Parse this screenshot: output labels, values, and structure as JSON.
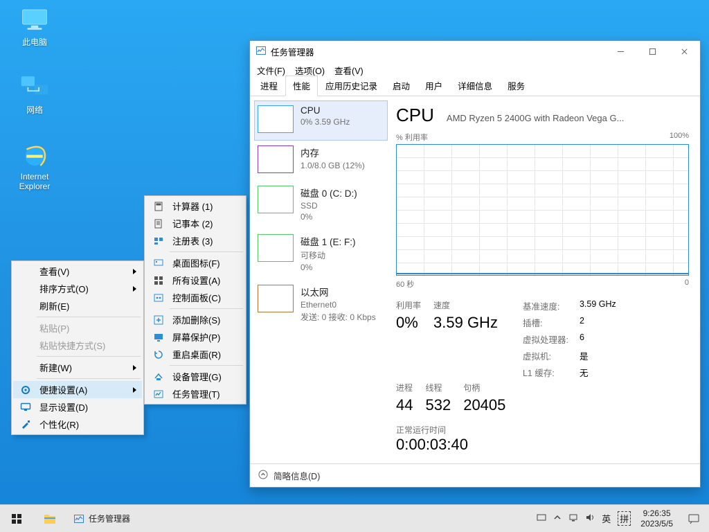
{
  "desktop": {
    "icons": [
      {
        "key": "this-pc",
        "label": "此电脑"
      },
      {
        "key": "network",
        "label": "网络"
      },
      {
        "key": "ie",
        "label": "Internet Explorer"
      }
    ]
  },
  "context_menu": {
    "items": [
      {
        "label": "查看(V)",
        "type": "submenu"
      },
      {
        "label": "排序方式(O)",
        "type": "submenu"
      },
      {
        "label": "刷新(E)",
        "type": "item"
      },
      {
        "label": "sep"
      },
      {
        "label": "粘贴(P)",
        "type": "disabled"
      },
      {
        "label": "粘贴快捷方式(S)",
        "type": "disabled"
      },
      {
        "label": "sep"
      },
      {
        "label": "新建(W)",
        "type": "submenu"
      },
      {
        "label": "sep"
      },
      {
        "label": "便捷设置(A)",
        "type": "submenu",
        "icon": "gear",
        "active": true
      },
      {
        "label": "显示设置(D)",
        "type": "item",
        "icon": "display"
      },
      {
        "label": "个性化(R)",
        "type": "item",
        "icon": "brush"
      }
    ],
    "submenu": [
      {
        "label": "计算器  (1)",
        "icon": "calc"
      },
      {
        "label": "记事本  (2)",
        "icon": "notepad"
      },
      {
        "label": "注册表  (3)",
        "icon": "registry"
      },
      {
        "label": "sep"
      },
      {
        "label": "桌面图标(F)",
        "icon": "desktop-icons"
      },
      {
        "label": "所有设置(A)",
        "icon": "settings-grid"
      },
      {
        "label": "控制面板(C)",
        "icon": "control-panel"
      },
      {
        "label": "sep"
      },
      {
        "label": "添加删除(S)",
        "icon": "apps"
      },
      {
        "label": "屏幕保护(P)",
        "icon": "screensaver"
      },
      {
        "label": "重启桌面(R)",
        "icon": "restart"
      },
      {
        "label": "sep"
      },
      {
        "label": "设备管理(G)",
        "icon": "devicemgr"
      },
      {
        "label": "任务管理(T)",
        "icon": "taskmgr"
      }
    ]
  },
  "taskmgr": {
    "title": "任务管理器",
    "menus": [
      "文件(F)",
      "选项(O)",
      "查看(V)"
    ],
    "tabs": [
      "进程",
      "性能",
      "应用历史记录",
      "启动",
      "用户",
      "详细信息",
      "服务"
    ],
    "active_tab": 1,
    "side": [
      {
        "key": "cpu",
        "title": "CPU",
        "sub": "0% 3.59 GHz"
      },
      {
        "key": "mem",
        "title": "内存",
        "sub": "1.0/8.0 GB (12%)"
      },
      {
        "key": "d0",
        "title": "磁盘 0 (C: D:)",
        "sub1": "SSD",
        "sub2": "0%"
      },
      {
        "key": "d1",
        "title": "磁盘 1 (E: F:)",
        "sub1": "可移动",
        "sub2": "0%"
      },
      {
        "key": "eth",
        "title": "以太网",
        "sub1": "Ethernet0",
        "sub2": "发送: 0 接收: 0 Kbps"
      }
    ],
    "active_side": 0,
    "main": {
      "heading": "CPU",
      "model": "AMD Ryzen 5 2400G with Radeon Vega G...",
      "ylabel": "% 利用率",
      "ymax": "100%",
      "xl": "60 秒",
      "xr": "0"
    },
    "stats": {
      "利用率": "0%",
      "速度": "3.59 GHz",
      "进程": "44",
      "线程": "532",
      "句柄": "20405"
    },
    "kv": [
      [
        "基准速度:",
        "3.59 GHz"
      ],
      [
        "插槽:",
        "2"
      ],
      [
        "虚拟处理器:",
        "6"
      ],
      [
        "虚拟机:",
        "是"
      ],
      [
        "L1 缓存:",
        "无"
      ]
    ],
    "uptime_label": "正常运行时间",
    "uptime": "0:00:03:40",
    "footer": "简略信息(D)"
  },
  "taskbar": {
    "task_title": "任务管理器",
    "ime1": "英",
    "ime2": "拼",
    "time": "9:26:35",
    "date": "2023/5/5"
  },
  "chart_data": {
    "type": "line",
    "title": "CPU % 利用率",
    "xlabel": "秒",
    "ylabel": "% 利用率",
    "ylim": [
      0,
      100
    ],
    "x_range_seconds": [
      60,
      0
    ],
    "series": [
      {
        "name": "CPU",
        "values": [
          1,
          0,
          1,
          1,
          0,
          1,
          2,
          1,
          0,
          1,
          1,
          0,
          1,
          1,
          0,
          1,
          1,
          2,
          1,
          0,
          1,
          1,
          0,
          1,
          1,
          0,
          1,
          1,
          0,
          1,
          2,
          1,
          0,
          1,
          1,
          0,
          1,
          1,
          0,
          1,
          1,
          0,
          1,
          1,
          0,
          1,
          1,
          0,
          1,
          1,
          0,
          1,
          1,
          0,
          1,
          1,
          0,
          1,
          1,
          0
        ]
      }
    ]
  }
}
